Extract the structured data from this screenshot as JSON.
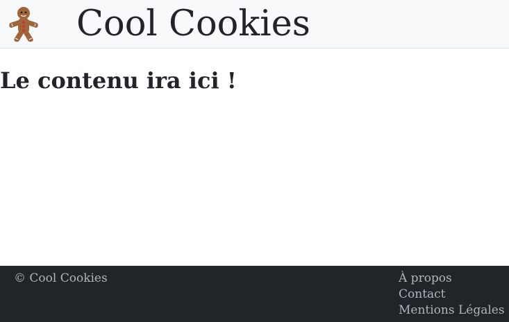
{
  "header": {
    "logo_icon": "gingerbread-man-icon",
    "title": "Cool Cookies"
  },
  "main": {
    "heading": "Le contenu ira ici !"
  },
  "footer": {
    "copyright": "© Cool Cookies",
    "links": [
      {
        "label": "À propos"
      },
      {
        "label": "Contact"
      },
      {
        "label": "Mentions Légales"
      }
    ]
  },
  "colors": {
    "header_bg": "#f8f9fa",
    "footer_bg": "#212529",
    "footer_text": "#adb5bd",
    "text": "#212529",
    "cookie_brown": "#a0643a"
  }
}
